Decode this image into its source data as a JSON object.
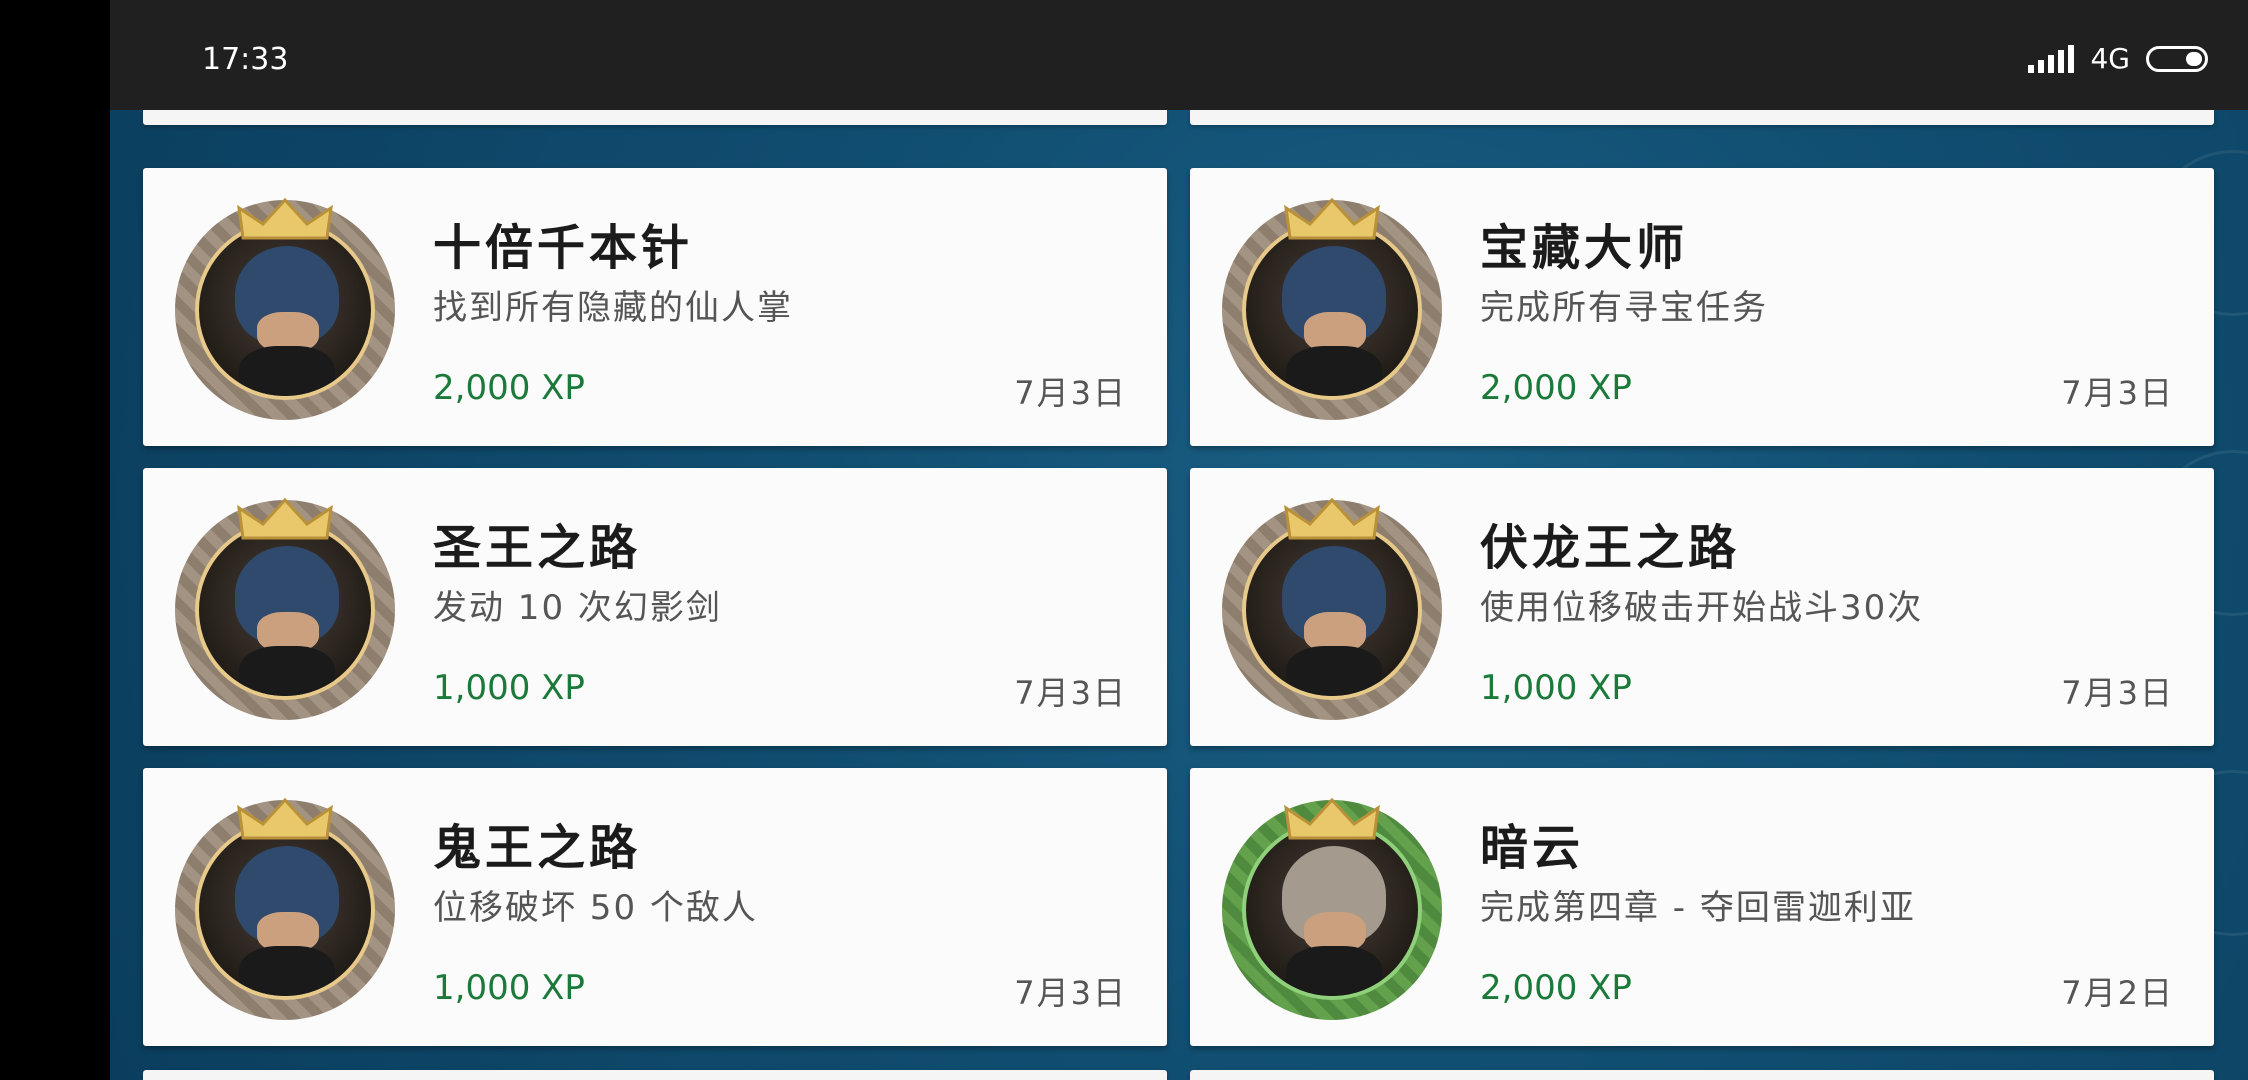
{
  "status_bar": {
    "time": "17:33",
    "network": "4G"
  },
  "achievements": [
    {
      "title": "十倍千本针",
      "description": "找到所有隐藏的仙人掌",
      "xp": "2,000 XP",
      "date": "7月3日",
      "avatar": "noctis-portrait-icon",
      "frame_color": "#9c8c7a"
    },
    {
      "title": "宝藏大师",
      "description": "完成所有寻宝任务",
      "xp": "2,000 XP",
      "date": "7月3日",
      "avatar": "noctis-portrait-icon",
      "frame_color": "#9c8c7a"
    },
    {
      "title": "圣王之路",
      "description": "发动 10 次幻影剑",
      "xp": "1,000 XP",
      "date": "7月3日",
      "avatar": "noctis-portrait-icon",
      "frame_color": "#9c8c7a"
    },
    {
      "title": "伏龙王之路",
      "description": "使用位移破击开始战斗30次",
      "xp": "1,000 XP",
      "date": "7月3日",
      "avatar": "noctis-portrait-icon",
      "frame_color": "#9c8c7a"
    },
    {
      "title": "鬼王之路",
      "description": "位移破坏 50 个敌人",
      "xp": "1,000 XP",
      "date": "7月3日",
      "avatar": "noctis-portrait-icon",
      "frame_color": "#9c8c7a"
    },
    {
      "title": "暗云",
      "description": "完成第四章 - 夺回雷迦利亚",
      "xp": "2,000 XP",
      "date": "7月2日",
      "avatar": "ardyn-portrait-icon",
      "frame_color": "#5a9845"
    }
  ],
  "colors": {
    "xp_text": "#1b7a3a",
    "background": "#104d70",
    "status_bar": "#202020"
  }
}
